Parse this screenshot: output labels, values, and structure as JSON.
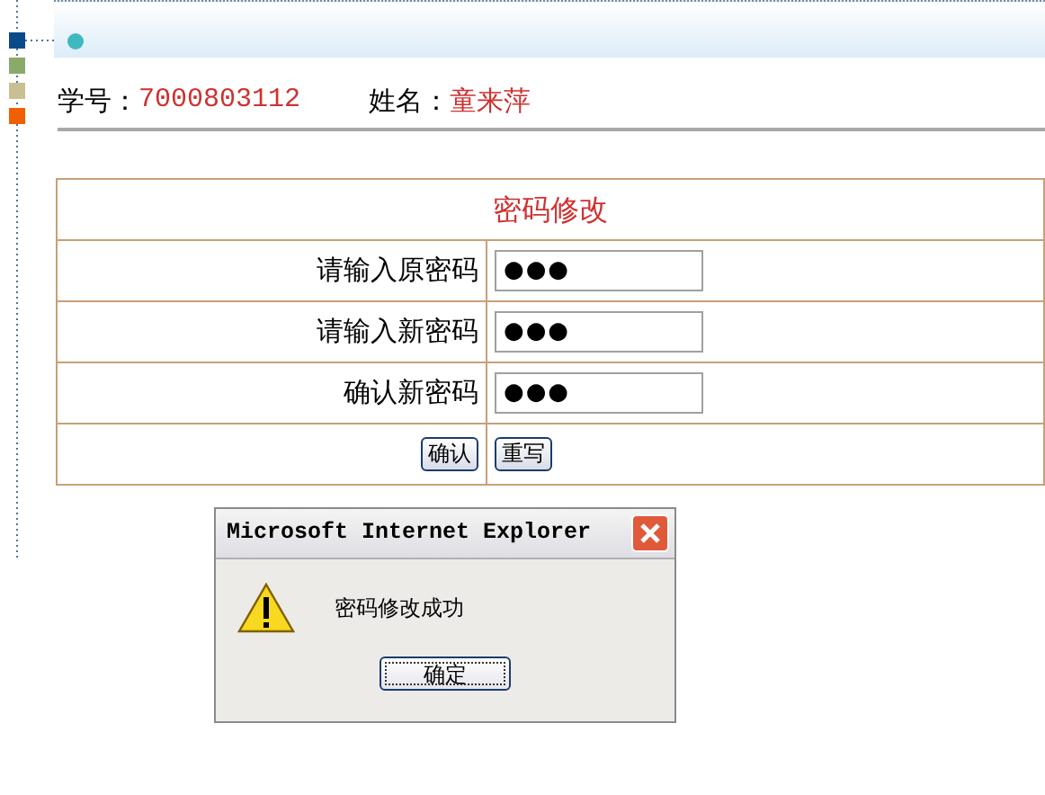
{
  "student": {
    "id_label": "学号：",
    "id": "7000803112",
    "name_label": "姓名：",
    "name": "童来萍"
  },
  "form": {
    "title": "密码修改",
    "fields": [
      {
        "label": "请输入原密码",
        "value": "●●●"
      },
      {
        "label": "请输入新密码",
        "value": "●●●"
      },
      {
        "label": "确认新密码",
        "value": "●●●"
      }
    ],
    "buttons": [
      "确认",
      "重写"
    ]
  },
  "dialog": {
    "title": "Microsoft Internet Explorer",
    "message": "密码修改成功",
    "button": "确定"
  }
}
